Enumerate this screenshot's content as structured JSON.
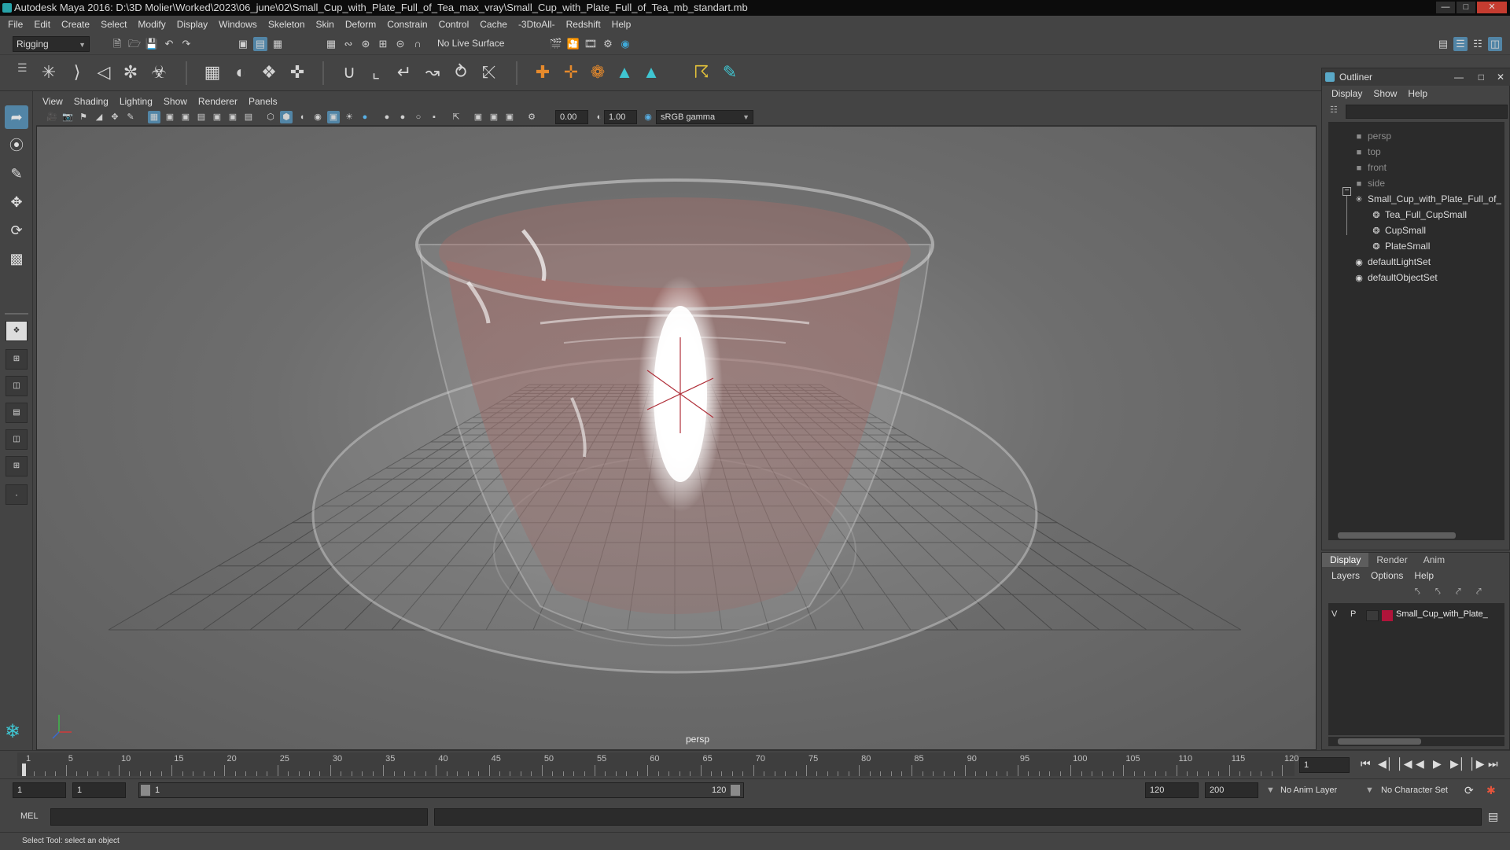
{
  "window": {
    "title": "Autodesk Maya 2016: D:\\3D Molier\\Worked\\2023\\06_june\\02\\Small_Cup_with_Plate_Full_of_Tea_max_vray\\Small_Cup_with_Plate_Full_of_Tea_mb_standart.mb"
  },
  "menubar": [
    "File",
    "Edit",
    "Create",
    "Select",
    "Modify",
    "Display",
    "Windows",
    "Skeleton",
    "Skin",
    "Deform",
    "Constrain",
    "Control",
    "Cache",
    "-3DtoAll-",
    "Redshift",
    "Help"
  ],
  "status": {
    "mode": "Rigging",
    "live_surface": "No Live Surface"
  },
  "panel_menu": [
    "View",
    "Shading",
    "Lighting",
    "Show",
    "Renderer",
    "Panels"
  ],
  "panel_toolbar": {
    "exposure": "0.00",
    "gamma": "1.00",
    "colorspace": "sRGB gamma"
  },
  "viewport": {
    "camera_label": "persp"
  },
  "outliner": {
    "title": "Outliner",
    "menu": [
      "Display",
      "Show",
      "Help"
    ],
    "items": [
      {
        "label": "persp",
        "icon": "camera-icon",
        "indent": 0,
        "dim": true
      },
      {
        "label": "top",
        "icon": "camera-icon",
        "indent": 0,
        "dim": true
      },
      {
        "label": "front",
        "icon": "camera-icon",
        "indent": 0,
        "dim": true
      },
      {
        "label": "side",
        "icon": "camera-icon",
        "indent": 0,
        "dim": true
      },
      {
        "label": "Small_Cup_with_Plate_Full_of_",
        "icon": "group-icon",
        "indent": 0,
        "dim": false
      },
      {
        "label": "Tea_Full_CupSmall",
        "icon": "mesh-icon",
        "indent": 1,
        "dim": false
      },
      {
        "label": "CupSmall",
        "icon": "mesh-icon",
        "indent": 1,
        "dim": false
      },
      {
        "label": "PlateSmall",
        "icon": "mesh-icon",
        "indent": 1,
        "dim": false
      },
      {
        "label": "defaultLightSet",
        "icon": "set-icon",
        "indent": 0,
        "dim": false
      },
      {
        "label": "defaultObjectSet",
        "icon": "set-icon",
        "indent": 0,
        "dim": false
      }
    ]
  },
  "layers": {
    "tabs": [
      "Display",
      "Render",
      "Anim"
    ],
    "menu": [
      "Layers",
      "Options",
      "Help"
    ],
    "row": {
      "v": "V",
      "p": "P",
      "name": "Small_Cup_with_Plate_",
      "color": "#b0143a"
    }
  },
  "timeline": {
    "ticks": [
      "1",
      "5",
      "10",
      "15",
      "20",
      "25",
      "30",
      "35",
      "40",
      "45",
      "50",
      "55",
      "60",
      "65",
      "70",
      "75",
      "80",
      "85",
      "90",
      "95",
      "100",
      "105",
      "110",
      "115",
      "120"
    ],
    "current": "1"
  },
  "range": {
    "start": "1",
    "start_inner": "1",
    "slider_start": "1",
    "slider_end": "120",
    "end_inner": "120",
    "end": "200",
    "anim_layer": "No Anim Layer",
    "char_set": "No Character Set"
  },
  "cmd": {
    "label": "MEL"
  },
  "help": {
    "text": "Select Tool: select an object"
  }
}
